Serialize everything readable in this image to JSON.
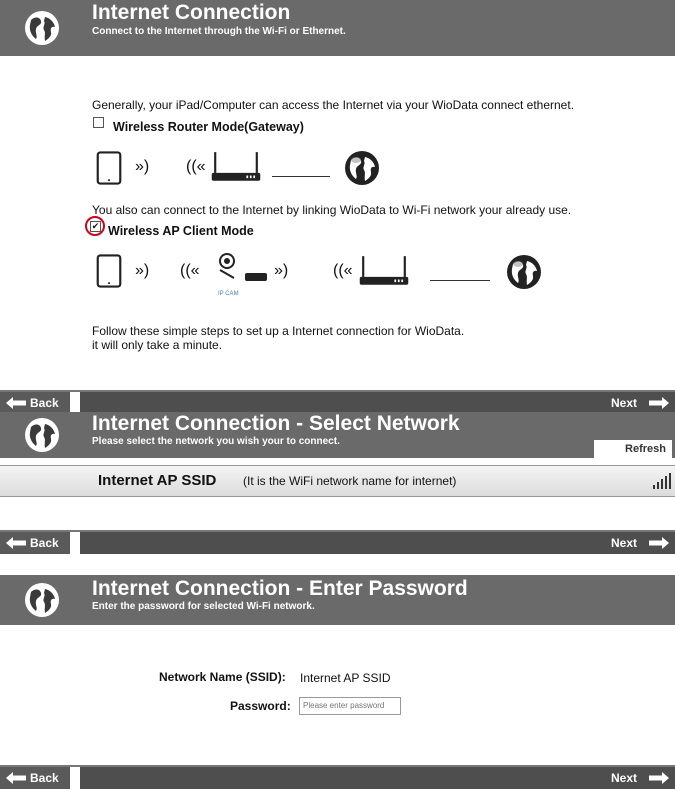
{
  "panel1": {
    "title": "Internet Connection",
    "subtitle": "Connect to the Internet through the Wi-Fi or Ethernet.",
    "intro": "Generally, your iPad/Computer can access the Internet via your WioData connect ethernet.",
    "option1_label": "Wireless Router Mode(Gateway)",
    "option1_checked": false,
    "middle_text": "You also can connect to the Internet by linking WioData to Wi-Fi network your already use.",
    "option2_label": "Wireless AP Client Mode",
    "option2_checked": true,
    "ipcam_label": "IP CAM",
    "footer_line1": "Follow these simple steps to set up a Internet connection for WioData.",
    "footer_line2": "it will only take a minute.",
    "back": "Back",
    "next": "Next"
  },
  "panel2": {
    "title": "Internet Connection - Select Network",
    "subtitle": "Please select the network you wish your to connect.",
    "refresh": "Refresh",
    "ssid_name": "Internet AP SSID",
    "ssid_note": "(It is the WiFi network name for internet)",
    "back": "Back",
    "next": "Next"
  },
  "panel3": {
    "title": "Internet Connection - Enter Password",
    "subtitle": "Enter the password for selected Wi-Fi network.",
    "ssid_label": "Network Name (SSID):",
    "ssid_value": "Internet AP SSID",
    "password_label": "Password:",
    "password_placeholder": "Please enter password",
    "back": "Back",
    "next": "Next"
  },
  "colors": {
    "header_bg": "#6a6a6a",
    "bar_bg": "#4e4e4e",
    "highlight": "#d0021b"
  }
}
